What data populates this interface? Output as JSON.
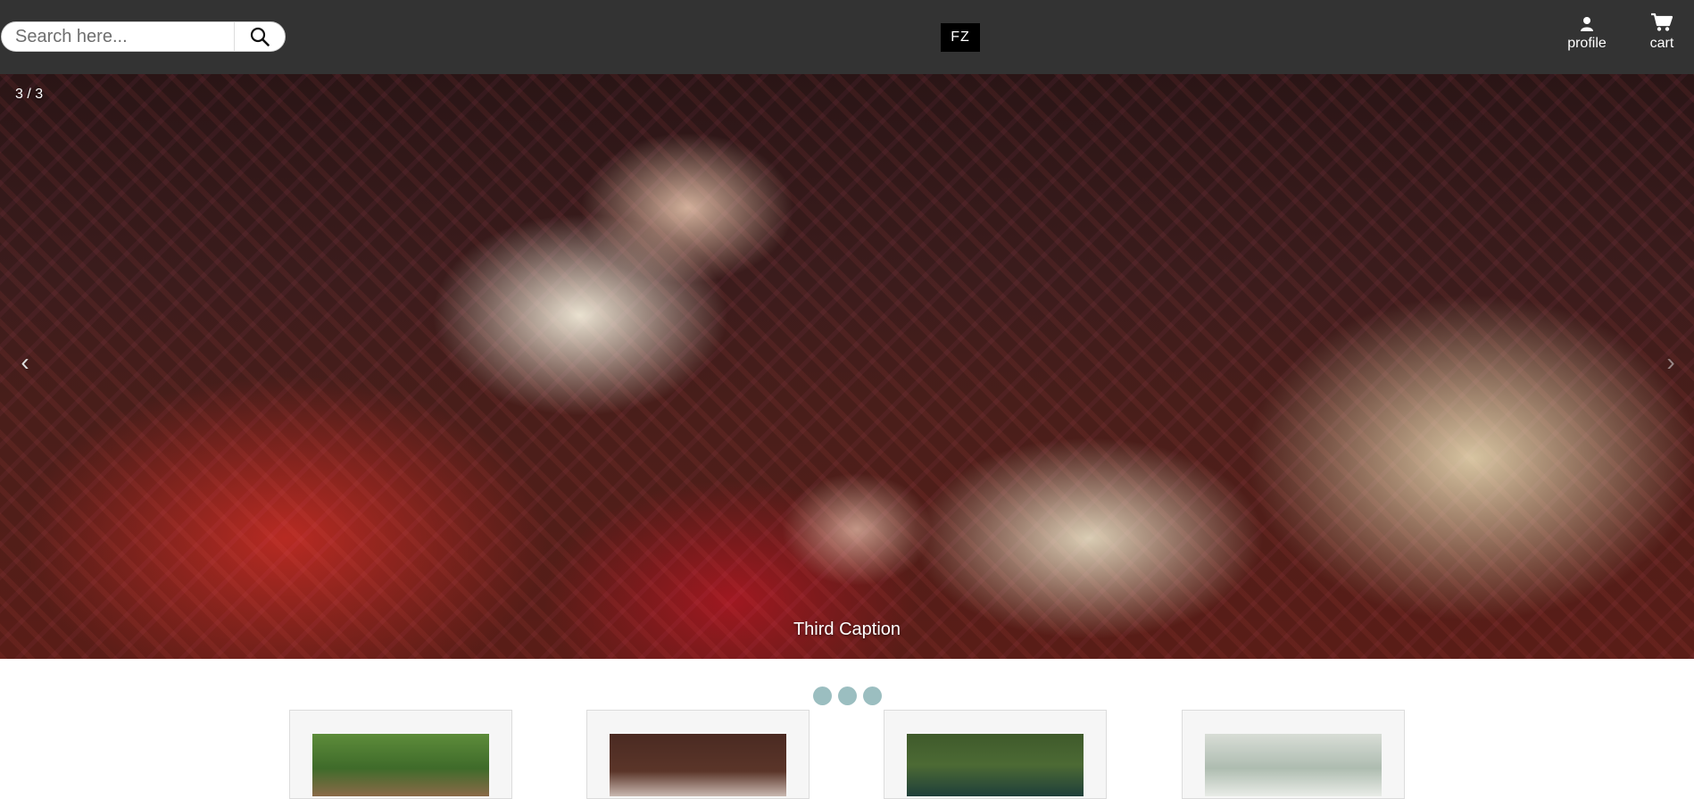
{
  "navbar": {
    "search": {
      "placeholder": "Search here...",
      "icon": "search-icon"
    },
    "logo": {
      "text": "FZ"
    },
    "profile": {
      "label": "profile",
      "icon": "person-icon"
    },
    "cart": {
      "label": "cart",
      "icon": "cart-icon"
    }
  },
  "carousel": {
    "counter": "3 / 3",
    "caption": "Third Caption",
    "prev_arrow": "‹",
    "next_arrow": "›",
    "current_slide": 3,
    "total_slides": 3
  },
  "products": {
    "cards": [
      {
        "image": "product-image-1"
      },
      {
        "image": "product-image-2"
      },
      {
        "image": "product-image-3"
      },
      {
        "image": "product-image-4"
      }
    ]
  },
  "colors": {
    "navbar": "#333333",
    "indicator": "#9bbec0",
    "card_bg": "#f6f6f6"
  }
}
